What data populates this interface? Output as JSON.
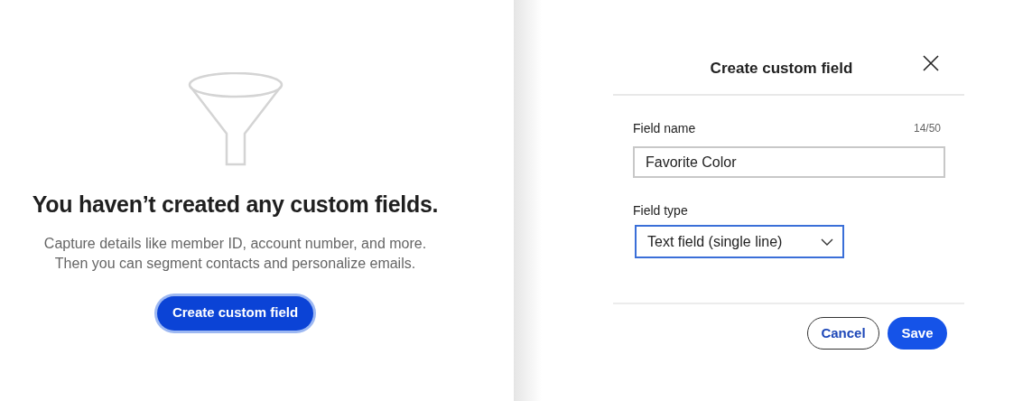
{
  "empty_state": {
    "title": "You haven’t created any custom fields.",
    "description": [
      "Capture details like member ID, account number, and more.",
      "Then you can segment contacts and personalize emails."
    ],
    "button": {
      "label": "Create custom field",
      "focused": true
    }
  },
  "dialog": {
    "title": "Create custom field",
    "fields": [
      {
        "kind": "text",
        "label": "Field name",
        "counter": "14/50",
        "value": "Favorite Color",
        "focused": false
      },
      {
        "kind": "select",
        "label": "Field type",
        "value": "Text field (single line)",
        "focused": true
      }
    ],
    "buttons": [
      {
        "kind": "secondary",
        "label": "Cancel"
      },
      {
        "kind": "primary",
        "label": "Save"
      }
    ]
  }
}
